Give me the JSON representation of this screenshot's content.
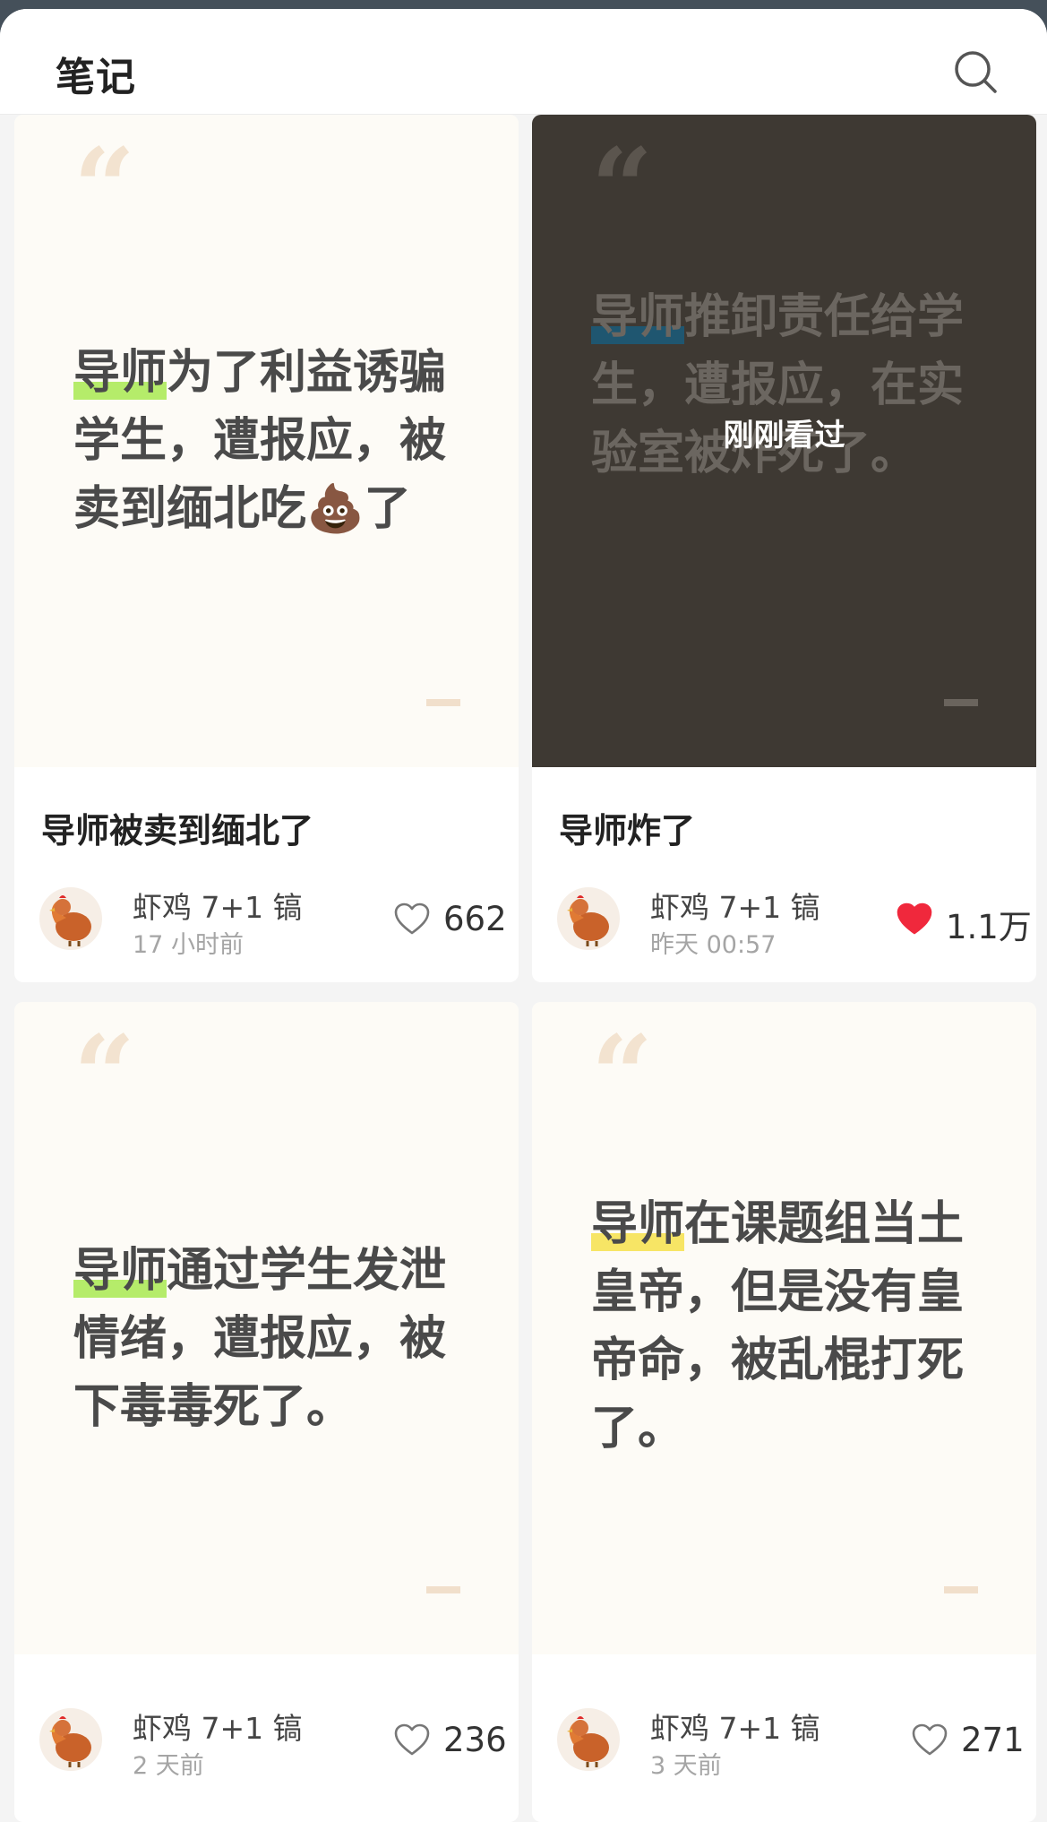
{
  "header": {
    "title": "笔记",
    "search_icon": "search-icon"
  },
  "notes": [
    {
      "highlight": "导师",
      "text": "为了利益诱骗学生，遭报应，被卖到缅北吃💩了",
      "title": "导师被卖到缅北了",
      "author": "虾鸡 7+1 镐",
      "time": "17 小时前",
      "likes": "662",
      "liked": false,
      "theme": "light",
      "highlight_color": "#b5ec6a"
    },
    {
      "highlight": "导师",
      "text": "推卸责任给学生，遭报应，在实验室被炸死了。",
      "title": "导师炸了",
      "author": "虾鸡 7+1 镐",
      "time": "昨天 00:57",
      "likes": "1.1万",
      "liked": true,
      "theme": "dark",
      "overlay": "刚刚看过",
      "highlight_color": "#1f5670",
      "like_color": "#f0283c"
    },
    {
      "highlight": "导师",
      "text": "通过学生发泄情绪，遭报应，被下毒毒死了。",
      "title": "",
      "author": "虾鸡 7+1 镐",
      "time": "2 天前",
      "likes": "236",
      "liked": false,
      "theme": "light",
      "highlight_color": "#b5ec6a"
    },
    {
      "highlight": "导师",
      "text": "在课题组当土皇帝，但是没有皇帝命，被乱棍打死了。",
      "title": "",
      "author": "虾鸡 7+1 镐",
      "time": "3 天前",
      "likes": "271",
      "liked": false,
      "theme": "light",
      "highlight_color": "#f7e565"
    }
  ]
}
